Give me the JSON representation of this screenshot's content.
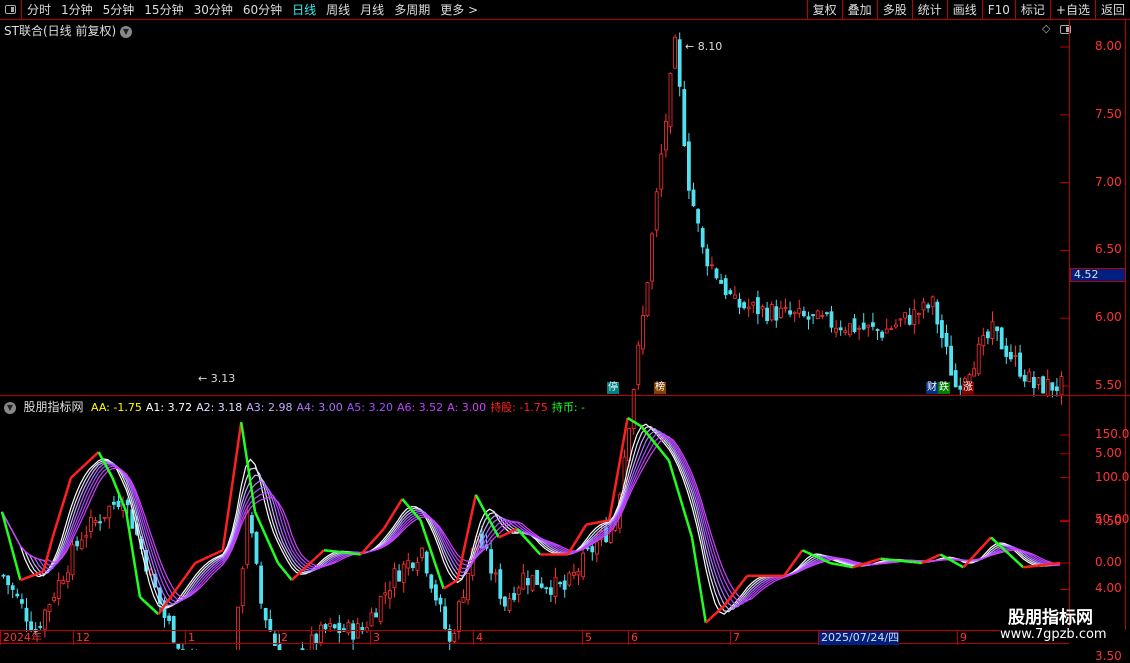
{
  "toolbar": {
    "periods": [
      "分时",
      "1分钟",
      "5分钟",
      "15分钟",
      "30分钟",
      "60分钟",
      "日线",
      "周线",
      "月线",
      "多周期",
      "更多 >"
    ],
    "active": "日线",
    "buttons": [
      "复权",
      "叠加",
      "多股",
      "统计",
      "画线",
      "F10",
      "标记",
      "+自选",
      "返回"
    ]
  },
  "stock": {
    "title": "ST联合(日线 前复权)",
    "current_price": "4.52",
    "high_label": "8.10",
    "low_label": "3.13"
  },
  "price_axis": [
    "8.00",
    "7.50",
    "7.00",
    "6.50",
    "6.00",
    "5.50",
    "5.00",
    "4.50",
    "4.00",
    "3.50"
  ],
  "indicator": {
    "name": "股朋指标网",
    "legend": [
      {
        "text": "AA: -1.75",
        "color": "#ffff00"
      },
      {
        "text": "A1: 3.72",
        "color": "#ffffff"
      },
      {
        "text": "A2: 3.18",
        "color": "#e0e0ff"
      },
      {
        "text": "A3: 2.98",
        "color": "#c8a8ff"
      },
      {
        "text": "A4: 3.00",
        "color": "#b070ff"
      },
      {
        "text": "A5: 3.20",
        "color": "#a050ff"
      },
      {
        "text": "A6: 3.52",
        "color": "#c040ff"
      },
      {
        "text": "A: 3.00",
        "color": "#d040ff"
      },
      {
        "text": "持股: -1.75",
        "color": "#ff2020"
      },
      {
        "text": "持币: -",
        "color": "#20ff20"
      }
    ],
    "axis": [
      "150.0",
      "100.0",
      "50.00",
      "0.00"
    ]
  },
  "markers": [
    {
      "text": "停",
      "color": "#008080"
    },
    {
      "text": "榜",
      "color": "#804000"
    },
    {
      "text": "财",
      "color": "#003080"
    },
    {
      "text": "跌",
      "color": "#008000"
    },
    {
      "text": "涨",
      "color": "#800000"
    }
  ],
  "dates": [
    "2024年",
    "12",
    "1",
    "2",
    "3",
    "4",
    "5",
    "6",
    "7",
    "2025/07/24/四",
    "9"
  ],
  "watermark": {
    "name": "股朋指标网",
    "url": "www.7gpzb.com"
  },
  "chart_data": {
    "type": "candlestick",
    "price_keypoints": [
      [
        0,
        4.1
      ],
      [
        7,
        3.7
      ],
      [
        17,
        4.4
      ],
      [
        26,
        4.7
      ],
      [
        35,
        3.8
      ],
      [
        43,
        3.3
      ],
      [
        50,
        3.4
      ],
      [
        53,
        4.6
      ],
      [
        56,
        3.9
      ],
      [
        61,
        3.4
      ],
      [
        70,
        3.7
      ],
      [
        78,
        3.7
      ],
      [
        85,
        4.1
      ],
      [
        91,
        4.3
      ],
      [
        97,
        3.6
      ],
      [
        103,
        4.4
      ],
      [
        109,
        3.9
      ],
      [
        113,
        4.1
      ],
      [
        122,
        4.0
      ],
      [
        128,
        4.3
      ],
      [
        133,
        4.5
      ],
      [
        139,
        6.0
      ],
      [
        143,
        7.2
      ],
      [
        146,
        8.0
      ],
      [
        149,
        7.0
      ],
      [
        152,
        6.5
      ],
      [
        159,
        6.1
      ],
      [
        174,
        6.0
      ],
      [
        191,
        5.9
      ],
      [
        202,
        6.1
      ],
      [
        207,
        5.5
      ],
      [
        215,
        5.9
      ],
      [
        224,
        5.5
      ],
      [
        230,
        5.5
      ]
    ],
    "indicator_keypoints": [
      [
        0,
        60
      ],
      [
        4,
        -20
      ],
      [
        9,
        -10
      ],
      [
        11,
        30
      ],
      [
        15,
        100
      ],
      [
        17,
        110
      ],
      [
        21,
        130
      ],
      [
        24,
        100
      ],
      [
        27,
        60
      ],
      [
        30,
        -40
      ],
      [
        34,
        -60
      ],
      [
        38,
        -30
      ],
      [
        42,
        0
      ],
      [
        48,
        15
      ],
      [
        52,
        165
      ],
      [
        55,
        60
      ],
      [
        60,
        0
      ],
      [
        63,
        -20
      ],
      [
        70,
        15
      ],
      [
        78,
        10
      ],
      [
        83,
        40
      ],
      [
        87,
        75
      ],
      [
        91,
        50
      ],
      [
        96,
        -30
      ],
      [
        99,
        -20
      ],
      [
        103,
        80
      ],
      [
        108,
        30
      ],
      [
        112,
        40
      ],
      [
        117,
        10
      ],
      [
        123,
        10
      ],
      [
        127,
        45
      ],
      [
        132,
        50
      ],
      [
        136,
        170
      ],
      [
        139,
        160
      ],
      [
        145,
        120
      ],
      [
        150,
        30
      ],
      [
        153,
        -70
      ],
      [
        157,
        -50
      ],
      [
        162,
        -15
      ],
      [
        170,
        -15
      ],
      [
        174,
        15
      ],
      [
        180,
        0
      ],
      [
        185,
        -5
      ],
      [
        191,
        5
      ],
      [
        200,
        0
      ],
      [
        204,
        10
      ],
      [
        209,
        -5
      ],
      [
        215,
        30
      ],
      [
        222,
        -5
      ],
      [
        230,
        0
      ]
    ],
    "price_range": [
      3.0,
      8.5
    ],
    "indicator_range": [
      -75,
      180
    ]
  }
}
